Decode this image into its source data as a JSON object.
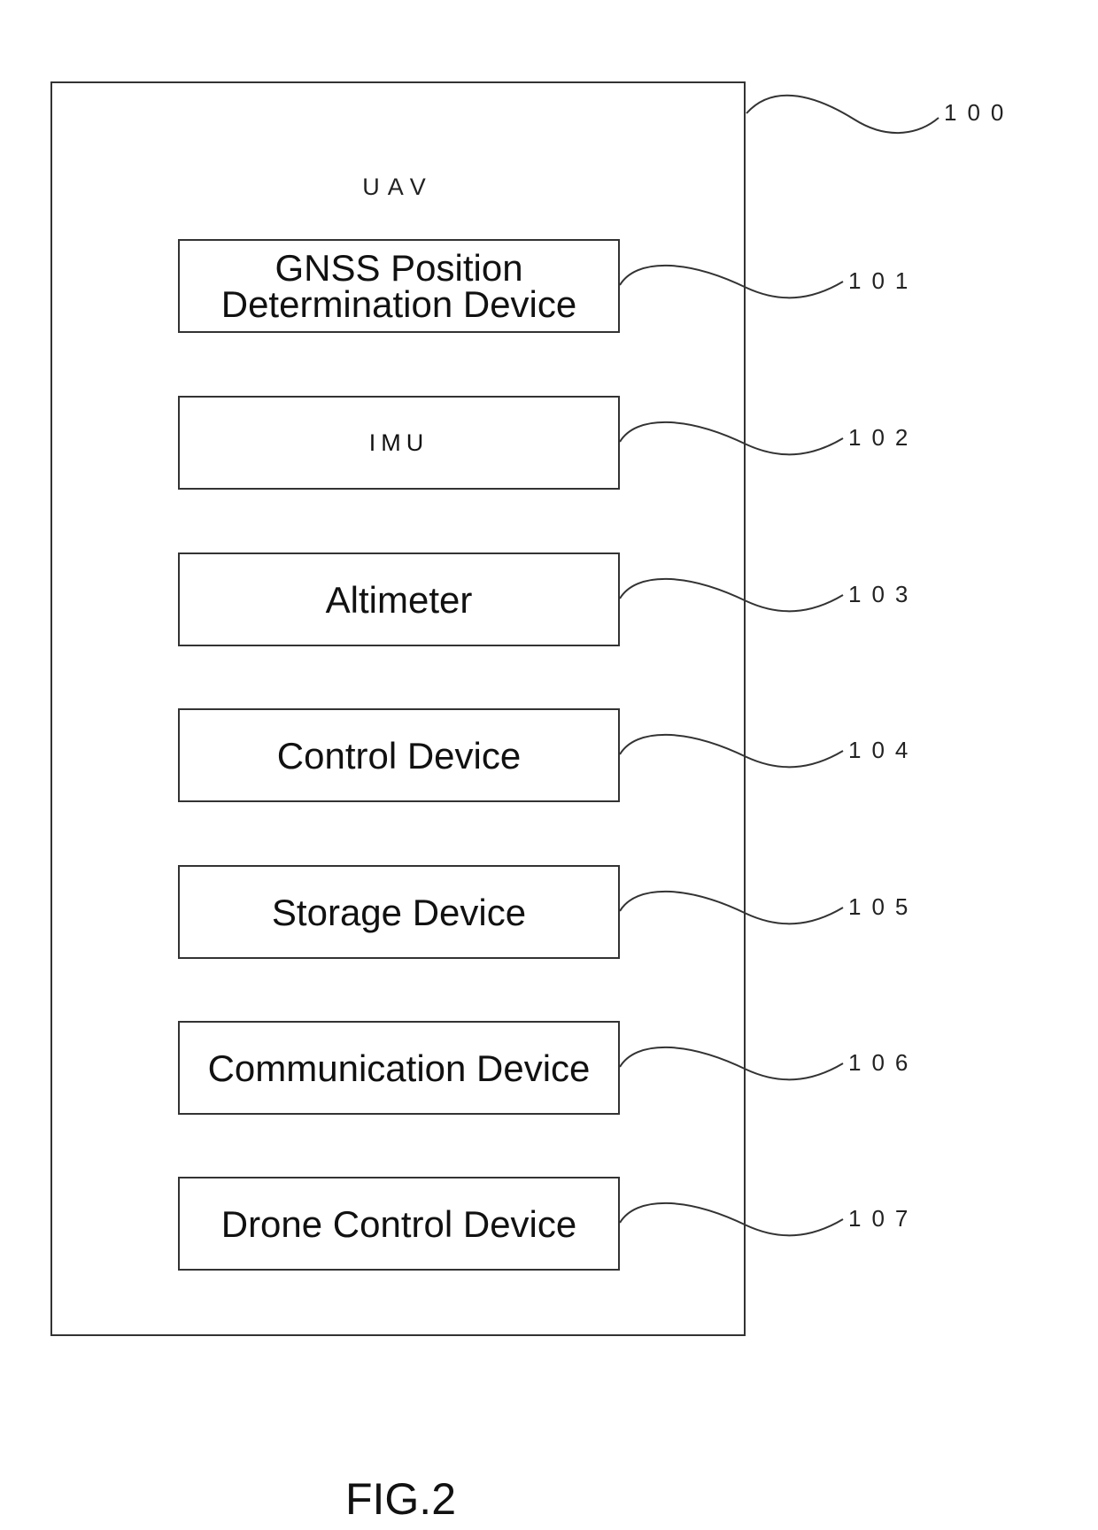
{
  "diagram": {
    "container": {
      "label": "UAV",
      "ref": "100"
    },
    "components": [
      {
        "label": "GNSS Position Determination Device",
        "ref": "101"
      },
      {
        "label": "IMU",
        "ref": "102"
      },
      {
        "label": "Altimeter",
        "ref": "103"
      },
      {
        "label": "Control Device",
        "ref": "104"
      },
      {
        "label": "Storage Device",
        "ref": "105"
      },
      {
        "label": "Communication Device",
        "ref": "106"
      },
      {
        "label": "Drone Control Device",
        "ref": "107"
      }
    ],
    "figure_caption": "FIG.2"
  }
}
